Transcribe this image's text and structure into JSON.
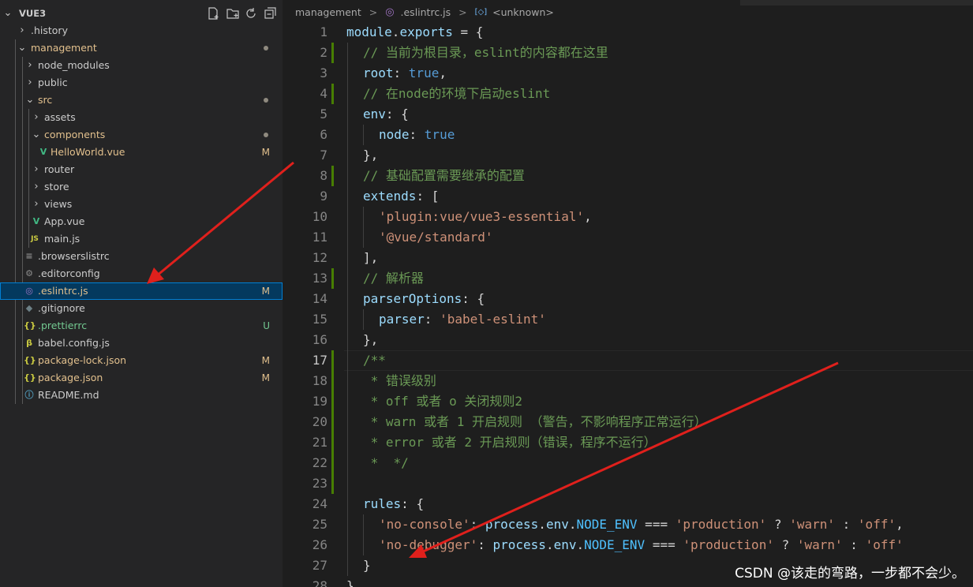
{
  "explorer": {
    "root": "VUE3",
    "items": [
      {
        "label": "history_prefix",
        "text": ".history"
      },
      {
        "text": "management"
      },
      {
        "text": "node_modules"
      },
      {
        "text": "public"
      },
      {
        "text": "src"
      },
      {
        "text": "assets"
      },
      {
        "text": "components"
      },
      {
        "text": "HelloWorld.vue",
        "status": "M"
      },
      {
        "text": "router"
      },
      {
        "text": "store"
      },
      {
        "text": "views"
      },
      {
        "text": "App.vue"
      },
      {
        "text": "main.js"
      },
      {
        "text": ".browserslistrc"
      },
      {
        "text": ".editorconfig"
      },
      {
        "text": ".eslintrc.js",
        "status": "M"
      },
      {
        "text": ".gitignore"
      },
      {
        "text": ".prettierrc",
        "status": "U"
      },
      {
        "text": "babel.config.js"
      },
      {
        "text": "package-lock.json",
        "status": "M"
      },
      {
        "text": "package.json",
        "status": "M"
      },
      {
        "text": "README.md"
      }
    ],
    "icons": {
      "js": "JS",
      "json": "{}",
      "vue": "V"
    }
  },
  "breadcrumb": {
    "folder": "management",
    "file": ".eslintrc.js",
    "symbol": "<unknown>",
    "separator": ">"
  },
  "editor": {
    "line_numbers": [
      "1",
      "2",
      "3",
      "4",
      "5",
      "6",
      "7",
      "8",
      "9",
      "10",
      "11",
      "12",
      "13",
      "14",
      "15",
      "16",
      "17",
      "18",
      "19",
      "20",
      "21",
      "22",
      "23",
      "24",
      "25",
      "26",
      "27",
      "28"
    ],
    "lines": {
      "l1a": "module",
      "l1b": ".",
      "l1c": "exports",
      "l1d": " = {",
      "l2": "// 当前为根目录，eslint的内容都在这里",
      "l3a": "root",
      "l3b": ": ",
      "l3c": "true",
      "l3d": ",",
      "l4": "// 在node的环境下启动eslint",
      "l5a": "env",
      "l5b": ": {",
      "l6a": "node",
      "l6b": ": ",
      "l6c": "true",
      "l7": "},",
      "l8": "// 基础配置需要继承的配置",
      "l9a": "extends",
      "l9b": ": [",
      "l10a": "'plugin:vue/vue3-essential'",
      "l10b": ",",
      "l11": "'@vue/standard'",
      "l12": "],",
      "l13": "// 解析器",
      "l14a": "parserOptions",
      "l14b": ": {",
      "l15a": "parser",
      "l15b": ": ",
      "l15c": "'babel-eslint'",
      "l16": "},",
      "l17": "/**",
      "l18": " * 错误级别",
      "l19": " * off 或者 o 关闭规则2",
      "l20": " * warn 或者 1 开启规则 （警告，不影响程序正常运行）",
      "l21": " * error 或者 2 开启规则（错误，程序不运行）",
      "l22": " *  */",
      "l24a": "rules",
      "l24b": ": {",
      "l25a": "'no-console'",
      "l25b": ": ",
      "l25c": "process",
      "l25d": ".",
      "l25e": "env",
      "l25f": ".",
      "l25g": "NODE_ENV",
      "l25h": " === ",
      "l25i": "'production'",
      "l25j": " ? ",
      "l25k": "'warn'",
      "l25l": " : ",
      "l25m": "'off'",
      "l25n": ",",
      "l26a": "'no-debugger'",
      "l26m": "'off'",
      "l27": "}",
      "l28": "}"
    }
  },
  "watermark": "CSDN @该走的弯路，一步都不会少。",
  "colors": {
    "keyword": "#569cd6",
    "property": "#9cdcfe",
    "string": "#ce9178",
    "comment": "#6a9955",
    "constant": "#4fc1ff",
    "arrow": "#e0201c",
    "git_modified": "#e2c08d",
    "git_untracked": "#73c991"
  }
}
